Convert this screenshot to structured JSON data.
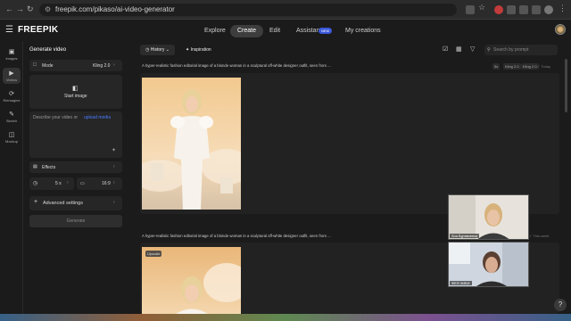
{
  "browser": {
    "url": "freepik.com/pikaso/ai-video-generator",
    "back_icon": "back-arrow",
    "forward_icon": "forward-arrow",
    "reload_icon": "reload"
  },
  "app": {
    "logo": "FREEPIK",
    "nav": {
      "explore": "Explore",
      "create": "Create",
      "edit": "Edit",
      "assistant": "Assistant",
      "new_badge": "NEW",
      "my_creations": "My creations"
    }
  },
  "rail": {
    "images": "Images",
    "videos": "Videos",
    "reimagine": "Reimagine",
    "sketch": "Sketch",
    "mockup": "Mockup"
  },
  "generate": {
    "title": "Generate video",
    "mode_label": "Mode",
    "mode_value": "Kling 2.0",
    "start_image": "Start image",
    "describe_text": "Describe your video or ",
    "upload_link": "upload media",
    "effects": "Effects",
    "duration": "5 s",
    "ratio": "16:9",
    "advanced": "Advanced settings",
    "generate_button": "Generate"
  },
  "toolbar": {
    "history": "History",
    "inspiration": "Inspiration",
    "search_placeholder": "Search by prompt"
  },
  "feed": [
    {
      "prompt": "A hyper-realistic fashion editorial image of a blonde woman in a sculptural off-white designer outfit, seen from ...",
      "tags": [
        "5s",
        "Kling 2.0",
        "Kling 2.0"
      ],
      "stamp": "Today"
    },
    {
      "prompt": "A hyper-realistic fashion editorial image of a blonde woman in a sculptural off-white designer outfit, seen from ...",
      "badge": "Upscale",
      "stamp": "This week"
    }
  ],
  "participants": [
    {
      "name": "Зоя Бурявченко"
    },
    {
      "name": "ФЕЯ ЗИБИ"
    }
  ],
  "colors": {
    "accent_link": "#4a7bff",
    "badge_blue": "#3a57d8",
    "background": "#1b1b1b"
  }
}
